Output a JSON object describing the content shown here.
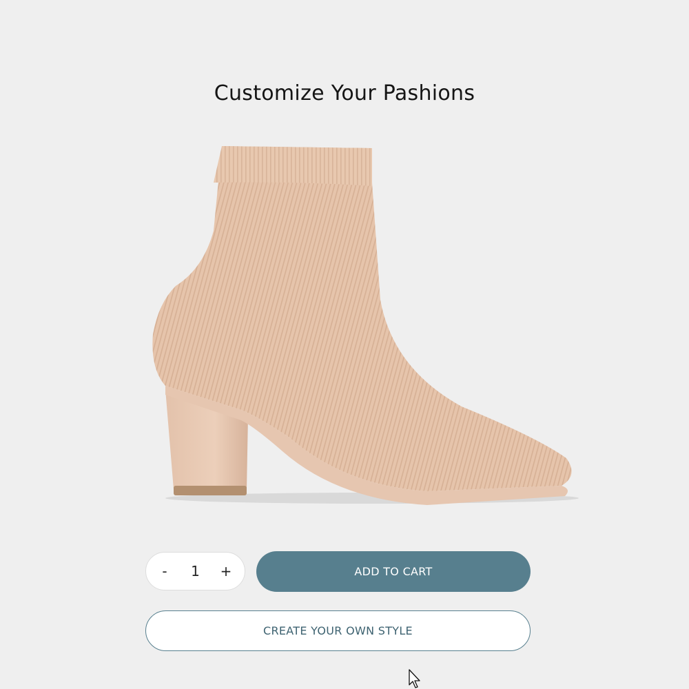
{
  "page": {
    "title": "Customize Your Pashions"
  },
  "product": {
    "image_icon": "ankle-boot-image",
    "color": "#e5c3aa"
  },
  "quantity": {
    "decrement_label": "-",
    "value": "1",
    "increment_label": "+"
  },
  "actions": {
    "add_to_cart_label": "ADD TO CART",
    "create_style_label": "CREATE YOUR OWN STYLE"
  },
  "colors": {
    "accent": "#577f8e",
    "background": "#efefef"
  }
}
